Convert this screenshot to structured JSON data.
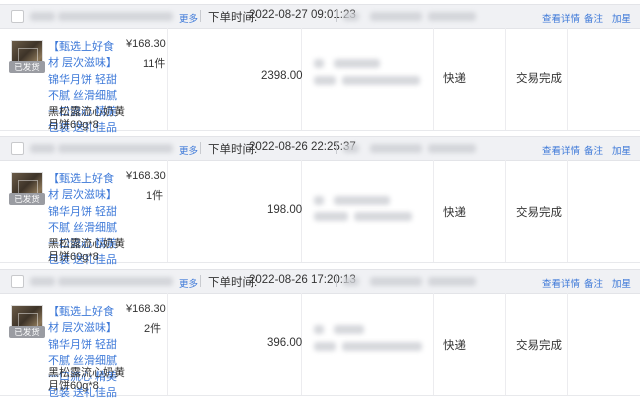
{
  "orders": [
    {
      "more_label": "更多",
      "time_label": "下单时间:",
      "time": "2022-08-27 09:01:23",
      "actions": [
        "查看详情",
        "备注",
        "加星"
      ],
      "tag": "已发货",
      "product_title": "【甄选上好食材 层次滋味】锦华月饼 轻甜不腻 丝滑细腻 一口流心 精美包装 送礼佳品",
      "product_spec": "黑松露流心奶黄月饼60g*8",
      "price": "¥168.30",
      "qty": "11件",
      "amount": "2398.00",
      "shipping": "快递",
      "status": "交易完成"
    },
    {
      "more_label": "更多",
      "time_label": "下单时间:",
      "time": "2022-08-26 22:25:37",
      "actions": [
        "查看详情",
        "备注",
        "加星"
      ],
      "tag": "已发货",
      "product_title": "【甄选上好食材 层次滋味】锦华月饼 轻甜不腻 丝滑细腻 一口流心 精美包装 送礼佳品",
      "product_spec": "黑松露流心奶黄月饼60g*8",
      "price": "¥168.30",
      "qty": "1件",
      "amount": "198.00",
      "shipping": "快递",
      "status": "交易完成"
    },
    {
      "more_label": "更多",
      "time_label": "下单时间:",
      "time": "2022-08-26 17:20:13",
      "actions": [
        "查看详情",
        "备注",
        "加星"
      ],
      "tag": "已发货",
      "product_title": "【甄选上好食材 层次滋味】锦华月饼 轻甜不腻 丝滑细腻 一口流心 精美包装 送礼佳品",
      "product_spec": "黑松露流心奶黄月饼60g*8",
      "price": "¥168.30",
      "qty": "2件",
      "amount": "396.00",
      "shipping": "快递",
      "status": "交易完成"
    }
  ]
}
